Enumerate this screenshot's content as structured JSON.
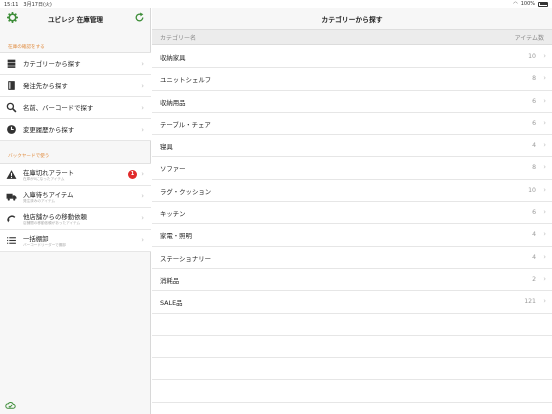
{
  "status": {
    "time_date": "15:11　3月17日(火)",
    "battery": "100%"
  },
  "sidebar": {
    "title": "ユビレジ 在庫管理",
    "section1_label": "在庫の確認をする",
    "section1_items": [
      {
        "label": "カテゴリーから探す",
        "icon": "box-icon"
      },
      {
        "label": "発注先から探す",
        "icon": "book-icon"
      },
      {
        "label": "名前、バーコードで探す",
        "icon": "search-icon"
      },
      {
        "label": "変更履歴から探す",
        "icon": "clock-icon"
      }
    ],
    "section2_label": "バックヤードで使う",
    "section2_items": [
      {
        "label": "在庫切れアラート",
        "sub": "在庫が0になったアイテム",
        "badge": "1",
        "icon": "warning-icon"
      },
      {
        "label": "入庫待ちアイテム",
        "sub": "発注済みのアイテム",
        "icon": "truck-icon"
      },
      {
        "label": "他店舗からの移動依頼",
        "sub": "店舗間の移動依頼があったアイテム",
        "icon": "transfer-icon"
      },
      {
        "label": "一括棚卸",
        "sub": "バーコードリーダーで棚卸",
        "icon": "list-icon"
      }
    ]
  },
  "main": {
    "title": "カテゴリーから探す",
    "col_name": "カテゴリー名",
    "col_count": "アイテム数",
    "rows": [
      {
        "name": "収納家具",
        "count": "10"
      },
      {
        "name": "ユニットシェルフ",
        "count": "8"
      },
      {
        "name": "収納用品",
        "count": "6"
      },
      {
        "name": "テーブル・チェア",
        "count": "6"
      },
      {
        "name": "寝具",
        "count": "4"
      },
      {
        "name": "ソファー",
        "count": "8"
      },
      {
        "name": "ラグ・クッション",
        "count": "10"
      },
      {
        "name": "キッチン",
        "count": "6"
      },
      {
        "name": "家電・照明",
        "count": "4"
      },
      {
        "name": "ステーショナリー",
        "count": "4"
      },
      {
        "name": "消耗品",
        "count": "2"
      },
      {
        "name": "SALE品",
        "count": "121"
      }
    ]
  },
  "colors": {
    "accent_green": "#3f8e3a",
    "section_label": "#e08a3c",
    "badge_red": "#e12b2b"
  }
}
